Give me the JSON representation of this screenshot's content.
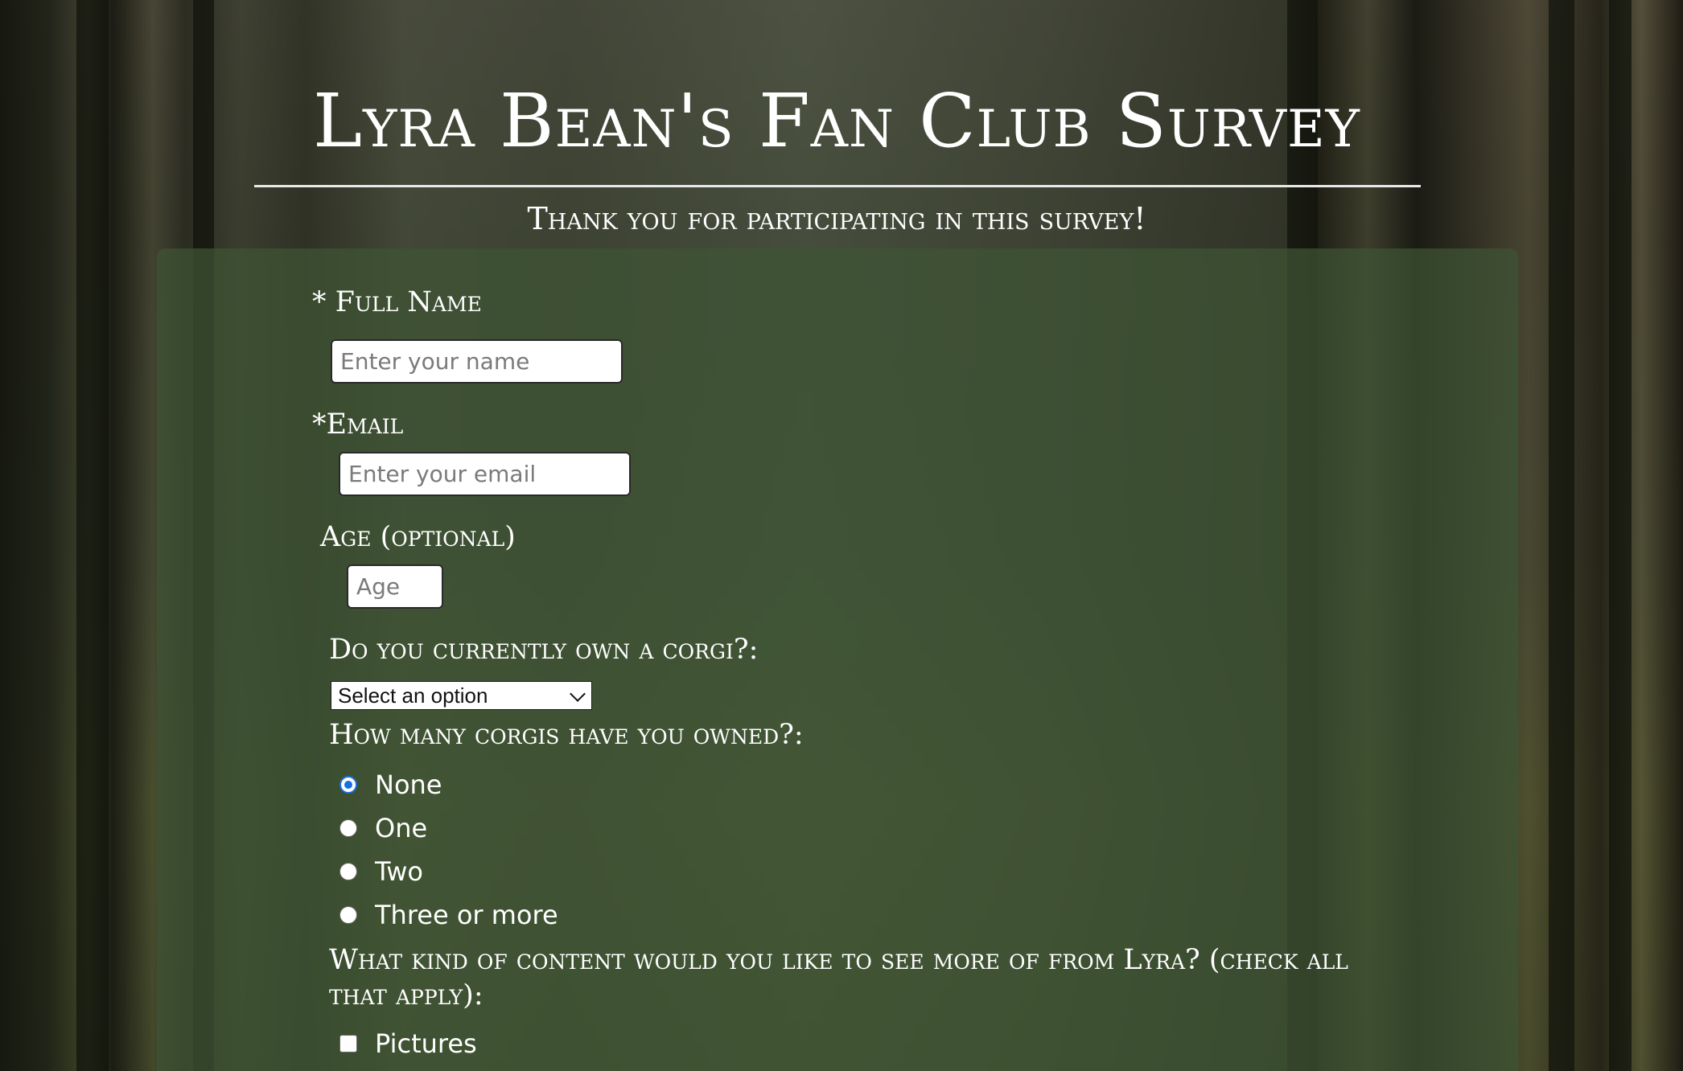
{
  "header": {
    "title": "Lyra Bean's Fan Club Survey",
    "subtitle": "Thank you for participating in this survey!"
  },
  "form": {
    "name": {
      "label": "* Full Name",
      "placeholder": "Enter your name"
    },
    "email": {
      "label": "*Email",
      "placeholder": "Enter your email"
    },
    "age": {
      "label": "Age (optional)",
      "placeholder": "Age"
    },
    "owns_corgi": {
      "label": "Do you currently own a corgi?:",
      "selected": "Select an option"
    },
    "corgis_owned": {
      "label": "How many corgis have you owned?:",
      "options": [
        "None",
        "One",
        "Two",
        "Three or more"
      ],
      "selected": "None"
    },
    "content": {
      "label": "What kind of content would you like to see more of from Lyra? (check all that apply):",
      "options": [
        "Pictures"
      ]
    }
  },
  "colors": {
    "panel": "#3e5434",
    "radio_accent": "#1a6fe0",
    "text": "#ffffff"
  }
}
